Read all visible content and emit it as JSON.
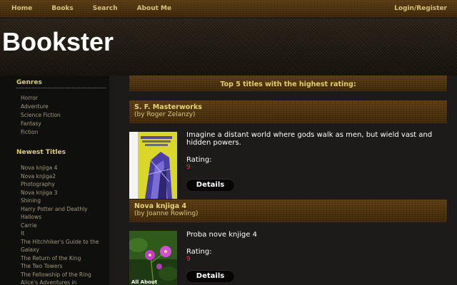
{
  "nav": {
    "home": "Home",
    "books": "Books",
    "search": "Search",
    "about": "About Me",
    "login": "Login/Register"
  },
  "site": {
    "title": "Bookster"
  },
  "sidebar": {
    "genres_title": "Genres",
    "genres": [
      "Horror",
      "Adventure",
      "Science Fiction",
      "Fantasy",
      "Fiction"
    ],
    "newest_title": "Newest Titles",
    "newest": [
      "Nova knjiga 4",
      "Nova knjiga2",
      "Photography",
      "Nova knjiga 3",
      "Shining",
      "Harry Potter and Deathly Hallows",
      "Carrie",
      "It",
      "The Hitchhiker's Guide to the Galaxy",
      "The Return of the King",
      "The Two Towers",
      "The Fellowship of the Ring",
      "Alice's Adventures in"
    ]
  },
  "main": {
    "top_title": "Top 5 titles with the highest rating:",
    "books": [
      {
        "title": "S. F. Masterworks",
        "author": "(by Roger Zelanzy)",
        "description": "Imagine a distant world where gods walk as men, but wield vast and hidden powers.",
        "rating_label": "Rating:",
        "rating": "9",
        "details": "Details"
      },
      {
        "title": "Nova knjiga 4",
        "author": "(by Joanne Rowling)",
        "description": "Proba nove knjige 4",
        "rating_label": "Rating:",
        "rating": "9",
        "details": "Details",
        "cover_text": "All About"
      }
    ]
  },
  "colors": {
    "accent_gold": "#e1cd6e",
    "wood_brown": "#4a3110",
    "rating_red": "#c0443a"
  }
}
